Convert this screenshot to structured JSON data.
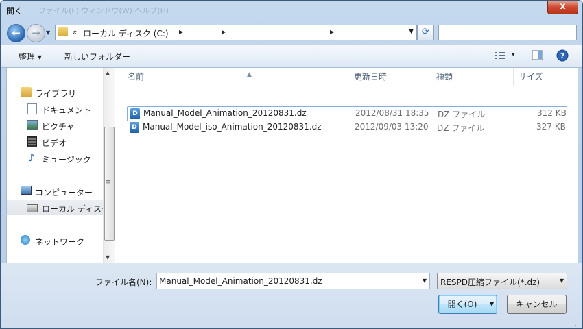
{
  "window": {
    "title": "開く",
    "ghost_menu": "ファイル(F)   ウィンドウ(W)   ヘルプ(H)",
    "close_label": "x"
  },
  "address": {
    "back_glyph": "←",
    "forward_glyph": "→",
    "overflow": "«",
    "crumbs": [
      "ローカル ディスク (C:)",
      "",
      ""
    ],
    "refresh_glyph": "⟳",
    "search_placeholder": ""
  },
  "toolbar": {
    "organize": "整理 ▾",
    "new_folder": "新しいフォルダー",
    "views_dropdown": "▾",
    "help": "?"
  },
  "nav": {
    "items": [
      {
        "label": "ライブラリ",
        "icon": "library-icon",
        "indent": 0
      },
      {
        "label": "ドキュメント",
        "icon": "documents-icon",
        "indent": 1
      },
      {
        "label": "ピクチャ",
        "icon": "pictures-icon",
        "indent": 1
      },
      {
        "label": "ビデオ",
        "icon": "video-icon",
        "indent": 1
      },
      {
        "label": "ミュージック",
        "icon": "music-icon",
        "indent": 1
      },
      {
        "label": "コンピューター",
        "icon": "computer-icon",
        "indent": 0
      },
      {
        "label": "ローカル ディスク",
        "icon": "local-disk-icon",
        "indent": 1
      },
      {
        "label": "ネットワーク",
        "icon": "network-icon",
        "indent": 0
      }
    ]
  },
  "columns": {
    "name": "名前",
    "date": "更新日時",
    "type": "種類",
    "size": "サイズ"
  },
  "files": [
    {
      "name": "Manual_Model_Animation_20120831.dz",
      "date": "2012/08/31 18:35",
      "type": "DZ ファイル",
      "size": "312 KB",
      "icon_text": "D"
    },
    {
      "name": "Manual_Model_iso_Animation_20120831.dz",
      "date": "2012/09/03 13:20",
      "type": "DZ ファイル",
      "size": "327 KB",
      "icon_text": "D"
    }
  ],
  "footer": {
    "filename_label": "ファイル名(N):",
    "filename_value": "Manual_Model_Animation_20120831.dz",
    "filter_value": "RESPD圧縮ファイル(*.dz)",
    "open_label": "開く(O)",
    "cancel_label": "キャンセル"
  }
}
